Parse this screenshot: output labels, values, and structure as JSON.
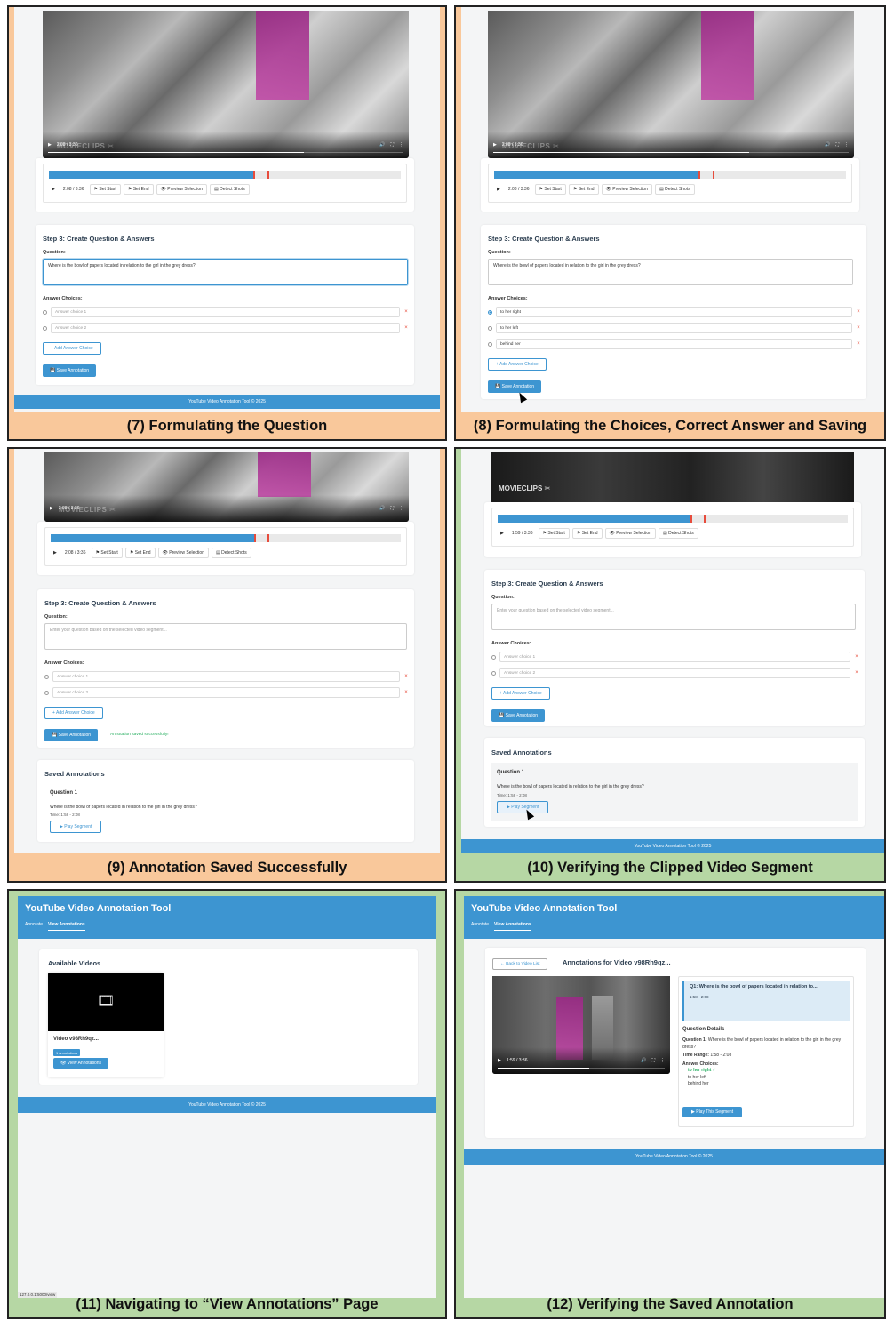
{
  "common": {
    "step_title": "Step 3: Create Question & Answers",
    "question_label": "Question:",
    "answer_label": "Answer Choices:",
    "question_placeholder": "Enter your question based on the selected video segment...",
    "choice1_ph": "Answer choice 1",
    "choice2_ph": "Answer choice 2",
    "add_choice": "+ Add Answer Choice",
    "save_btn": "💾 Save Annotation",
    "set_start": "⚑ Set Start",
    "set_end": "⚑ Set End",
    "preview": "👁 Preview Selection",
    "detect": "▤ Detect Shots",
    "footer": "YouTube Video Annotation Tool © 2025",
    "question_text": "Where is the bowl of papers located in relation to the girl in the grey dress?",
    "saved_title": "Saved Annotations",
    "q1": "Question 1",
    "play_segment": "▶ Play Segment",
    "watermark": "MOVIECLIPS ✂",
    "delete": "×"
  },
  "panel7": {
    "caption": "(7) Formulating the Question",
    "time": "2:08 / 3:36",
    "vtime": "2:08 / 3:36",
    "question_value": "Where is the bowl of papers located in relation to the girl in the grey dress?|",
    "progress": 0.73
  },
  "panel8": {
    "caption": "(8) Formulating the Choices, Correct Answer and Saving",
    "time": "2:08 / 3:36",
    "vtime": "2:08 / 3:36",
    "choices": [
      "to her right",
      "to her left",
      "behind her"
    ],
    "progress": 0.73
  },
  "panel9": {
    "caption": "(9) Annotation Saved Successfully",
    "time": "2:08 / 3:36",
    "vtime": "2:08 / 3:36",
    "success": "Annotation saved successfully!",
    "saved_time": "Time: 1:58 - 2:08",
    "progress": 0.73
  },
  "panel10": {
    "caption": "(10)    Verifying the Clipped Video Segment",
    "time": "1:59 / 3:36",
    "saved_time": "Time: 1:58 - 2:08",
    "progress": 0.55
  },
  "panel11": {
    "caption": "(11)    Navigating to “View Annotations” Page",
    "app_title": "YouTube Video Annotation Tool",
    "nav": [
      "Annotate",
      "View Annotations"
    ],
    "available": "Available Videos",
    "video_name": "Video v98Rh9qz...",
    "count_badge": "1 annotations",
    "view_btn": "👁 View Annotations",
    "film_icon": "🎞",
    "status_url": "127.0.0.1:5000/view"
  },
  "panel12": {
    "caption": "(12)    Verifying the Saved Annotation",
    "app_title": "YouTube Video Annotation Tool",
    "nav": [
      "Annotate",
      "View Annotations"
    ],
    "back": "← Back to Video List",
    "heading": "Annotations for Video v98Rh9qz...",
    "vtime": "1:59 / 3:36",
    "q_card": "Q1: Where is the bowl of papers located in relation to...",
    "q_card_time": "1:58 - 2:08",
    "details_title": "Question Details",
    "detail_q_label": "Question 1:",
    "detail_q": "Where is the bowl of papers located in relation to the girl in the grey dress?",
    "time_range_label": "Time Range:",
    "time_range": "1:58 - 2:08",
    "choices_label": "Answer Choices:",
    "correct": "to her right ✓",
    "other1": "to her left",
    "other2": "behind her",
    "play_this": "▶ Play This Segment"
  },
  "colors": {
    "accent": "#3d95d1",
    "marker": "#e74c3c",
    "success": "#27ae60",
    "orange_frame": "#f9c89b",
    "green_frame": "#b6d7a4"
  }
}
